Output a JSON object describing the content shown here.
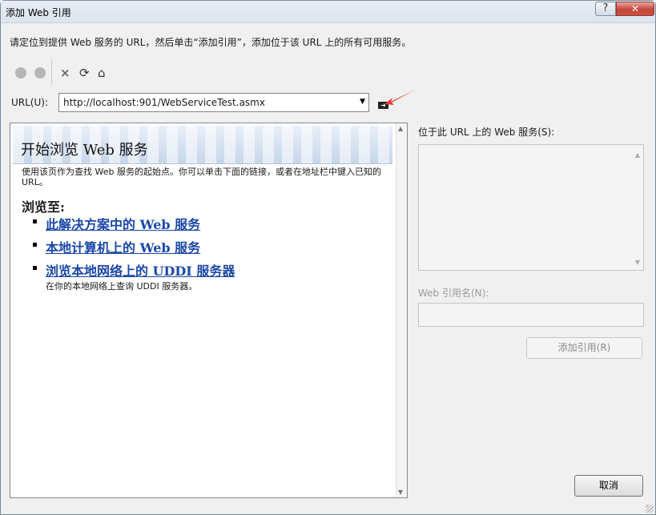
{
  "window": {
    "title": "添加 Web 引用"
  },
  "instruction": "请定位到提供 Web 服务的 URL，然后单击“添加引用”，添加位于该 URL 上的所有可用服务。",
  "toolbar": {
    "stop_icon": "×",
    "refresh_icon": "⟳",
    "home_icon": "⌂"
  },
  "url": {
    "label": "URL(U):",
    "value": "http://localhost:901/WebServiceTest.asmx",
    "go_icon": "go-arrow-icon"
  },
  "browser": {
    "banner_title": "开始浏览 Web 服务",
    "intro": "使用该页作为查找 Web 服务的起始点。你可以单击下面的链接，或者在地址栏中键入已知的 URL。",
    "browse_heading": "浏览至:",
    "links": [
      {
        "label": "此解决方案中的 Web 服务",
        "desc": ""
      },
      {
        "label": "本地计算机上的 Web 服务",
        "desc": ""
      },
      {
        "label": "浏览本地网络上的 UDDI 服务器",
        "desc": "在你的本地网络上查询 UDDI 服务器。"
      }
    ]
  },
  "right_panel": {
    "services_label": "位于此 URL 上的 Web 服务(S):",
    "webref_label": "Web 引用名(N):",
    "webref_value": "",
    "add_reference_button": "添加引用(R)",
    "cancel_button": "取消"
  },
  "colors": {
    "link": "#1a47a8",
    "close_button": "#c4463a",
    "annotation_arrow": "#e53935"
  }
}
